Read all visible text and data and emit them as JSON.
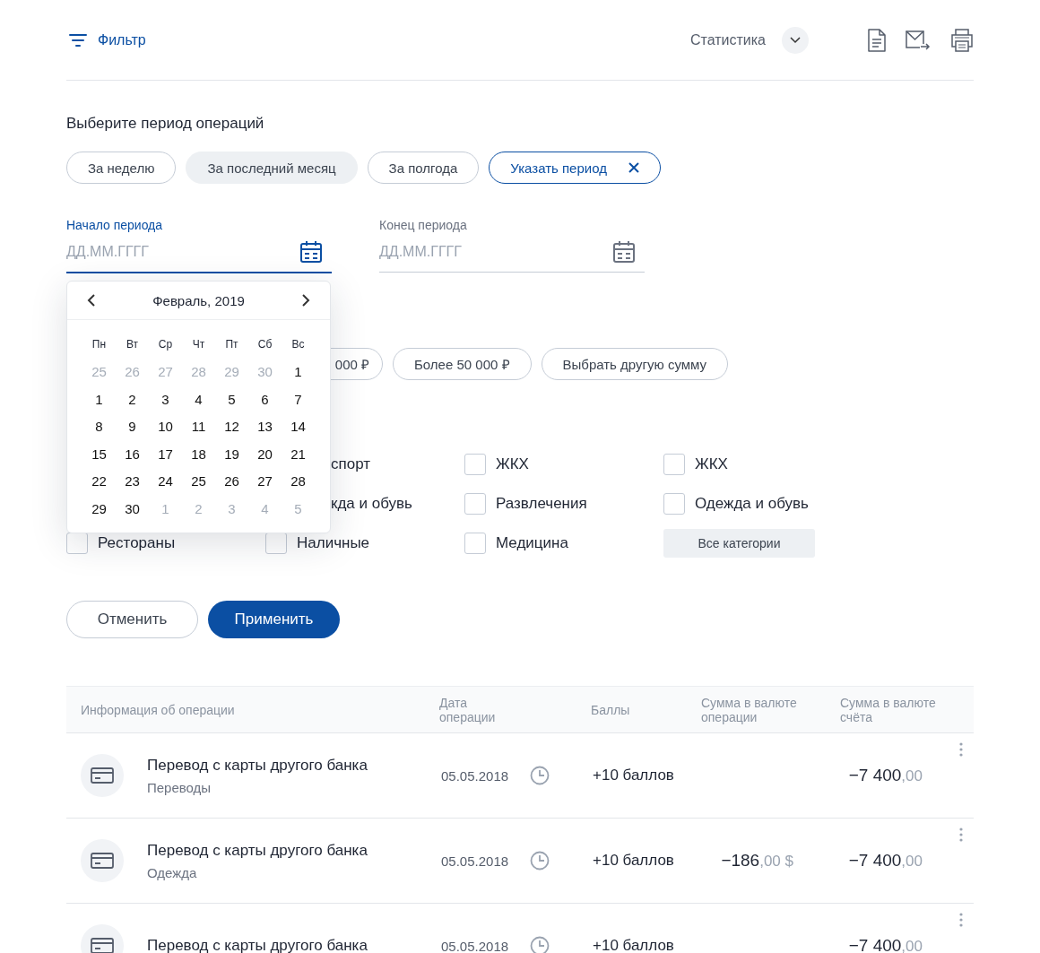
{
  "toolbar": {
    "filter_label": "Фильтр",
    "stats_label": "Статистика"
  },
  "period": {
    "title": "Выберите период операций",
    "chips": [
      {
        "label": "За неделю",
        "selected": false,
        "hovered": false
      },
      {
        "label": "За последний месяц",
        "selected": false,
        "hovered": true
      },
      {
        "label": "За полгода",
        "selected": false,
        "hovered": false
      },
      {
        "label": "Указать период",
        "selected": true,
        "hovered": false
      }
    ],
    "fields": [
      {
        "label": "Начало периода",
        "placeholder": "ДД.ММ.ГГГГ",
        "focused": true
      },
      {
        "label": "Конец периода",
        "placeholder": "ДД.ММ.ГГГГ",
        "focused": false
      }
    ]
  },
  "calendar": {
    "month": "Февраль, 2019",
    "weekdays": [
      "Пн",
      "Вт",
      "Ср",
      "Чт",
      "Пт",
      "Сб",
      "Вс"
    ],
    "weeks": [
      [
        {
          "day": "25",
          "muted": true
        },
        {
          "day": "26",
          "muted": true
        },
        {
          "day": "27",
          "muted": true
        },
        {
          "day": "28",
          "muted": true
        },
        {
          "day": "29",
          "muted": true
        },
        {
          "day": "30",
          "muted": true
        },
        {
          "day": "1",
          "muted": false
        }
      ],
      [
        {
          "day": "1",
          "muted": false
        },
        {
          "day": "2",
          "muted": false
        },
        {
          "day": "3",
          "muted": false
        },
        {
          "day": "4",
          "muted": false
        },
        {
          "day": "5",
          "muted": false
        },
        {
          "day": "6",
          "muted": false
        },
        {
          "day": "7",
          "muted": false
        }
      ],
      [
        {
          "day": "8",
          "muted": false
        },
        {
          "day": "9",
          "muted": false
        },
        {
          "day": "10",
          "muted": false
        },
        {
          "day": "11",
          "muted": false
        },
        {
          "day": "12",
          "muted": false
        },
        {
          "day": "13",
          "muted": false
        },
        {
          "day": "14",
          "muted": false
        }
      ],
      [
        {
          "day": "15",
          "muted": false
        },
        {
          "day": "16",
          "muted": false
        },
        {
          "day": "17",
          "muted": false
        },
        {
          "day": "18",
          "muted": false
        },
        {
          "day": "19",
          "muted": false
        },
        {
          "day": "20",
          "muted": false
        },
        {
          "day": "21",
          "muted": false
        }
      ],
      [
        {
          "day": "22",
          "muted": false
        },
        {
          "day": "23",
          "muted": false
        },
        {
          "day": "24",
          "muted": false
        },
        {
          "day": "25",
          "muted": false
        },
        {
          "day": "26",
          "muted": false
        },
        {
          "day": "27",
          "muted": false
        },
        {
          "day": "28",
          "muted": false
        }
      ],
      [
        {
          "day": "29",
          "muted": false
        },
        {
          "day": "30",
          "muted": false
        },
        {
          "day": "1",
          "muted": true
        },
        {
          "day": "2",
          "muted": true
        },
        {
          "day": "3",
          "muted": true
        },
        {
          "day": "4",
          "muted": true
        },
        {
          "day": "5",
          "muted": true
        }
      ]
    ]
  },
  "amount_chips": [
    {
      "label": "000 ₽",
      "kind": "partial"
    },
    {
      "label": "Более 50 000 ₽",
      "kind": "chip"
    },
    {
      "label": "Выбрать другую сумму",
      "kind": "chip"
    }
  ],
  "categories": {
    "items": [
      {
        "kind": "hidden"
      },
      {
        "label": "спорт",
        "kind": "partial"
      },
      {
        "label": "ЖКХ",
        "kind": "checkbox",
        "checked": false
      },
      {
        "label": "ЖКХ",
        "kind": "checkbox",
        "checked": false
      },
      {
        "kind": "hidden"
      },
      {
        "label": "кда и обувь",
        "kind": "partial"
      },
      {
        "label": "Развлечения",
        "kind": "checkbox",
        "checked": false
      },
      {
        "label": "Одежда и обувь",
        "kind": "checkbox",
        "checked": false
      },
      {
        "label": "Рестораны",
        "kind": "checkbox",
        "checked": false
      },
      {
        "label": "Наличные",
        "kind": "checkbox",
        "checked": false
      },
      {
        "label": "Медицина",
        "kind": "checkbox",
        "checked": false
      },
      {
        "label": "Все категории",
        "kind": "button"
      }
    ]
  },
  "actions": [
    {
      "label": "Отменить",
      "kind": "secondary"
    },
    {
      "label": "Применить",
      "kind": "primary"
    }
  ],
  "table": {
    "columns": [
      "Информация об операции",
      "Дата операции",
      "Баллы",
      "Сумма в валюте операции",
      "Сумма в валюте счёта"
    ],
    "rows": [
      {
        "title": "Перевод с карты другого банка",
        "category": "Переводы",
        "date": "05.05.2018",
        "points": "+10 баллов",
        "account_amount": {
          "main": "−7 400",
          "fraction": ",00"
        }
      },
      {
        "title": "Перевод с карты другого банка",
        "category": "Одежда",
        "date": "05.05.2018",
        "points": "+10 баллов",
        "operation_amount": {
          "main": "−186",
          "fraction": ",00 $"
        },
        "account_amount": {
          "main": "−7 400",
          "fraction": ",00"
        }
      },
      {
        "title": "Перевод с карты другого банка",
        "date": "05.05.2018",
        "points": "+10 баллов",
        "account_amount": {
          "main": "−7 400",
          "fraction": ",00"
        }
      }
    ]
  }
}
